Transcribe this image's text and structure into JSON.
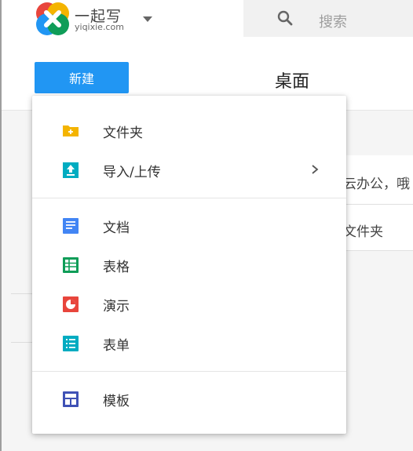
{
  "header": {
    "logo_name": "一起写",
    "logo_domain": "yiqixie.com",
    "search_placeholder": "搜索"
  },
  "toolbar": {
    "new_label": "新建",
    "page_title": "桌面"
  },
  "background": {
    "row_1_text": "家云办公，哦",
    "row_2_text": "套文件夹"
  },
  "menu": {
    "items": [
      {
        "label": "文件夹",
        "icon": "folder-add-icon",
        "color": "#f4b400"
      },
      {
        "label": "导入/上传",
        "icon": "upload-icon",
        "color": "#00acc1",
        "has_submenu": true
      },
      {
        "label": "文档",
        "icon": "document-icon",
        "color": "#4285f4"
      },
      {
        "label": "表格",
        "icon": "spreadsheet-icon",
        "color": "#0f9d58"
      },
      {
        "label": "演示",
        "icon": "presentation-icon",
        "color": "#e8453c"
      },
      {
        "label": "表单",
        "icon": "form-icon",
        "color": "#00acc1"
      },
      {
        "label": "模板",
        "icon": "template-icon",
        "color": "#3f51b5"
      }
    ]
  },
  "colors": {
    "accent": "#2196f3",
    "search_background": "#f1f1f1"
  }
}
